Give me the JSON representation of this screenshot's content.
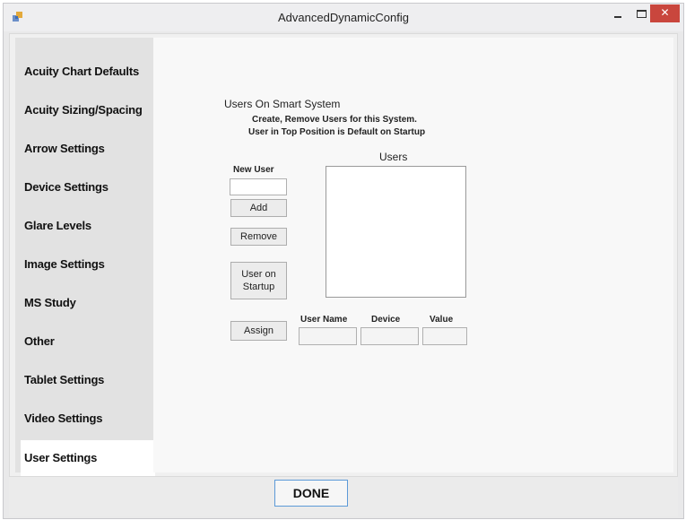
{
  "window": {
    "title": "AdvancedDynamicConfig",
    "controls": {
      "minimize": "–",
      "close": "✕"
    }
  },
  "sidebar": {
    "items": [
      {
        "label": "Acuity Chart Defaults"
      },
      {
        "label": "Acuity Sizing/Spacing"
      },
      {
        "label": "Arrow Settings"
      },
      {
        "label": "Device Settings"
      },
      {
        "label": "Glare Levels"
      },
      {
        "label": "Image Settings"
      },
      {
        "label": "MS Study"
      },
      {
        "label": "Other"
      },
      {
        "label": "Tablet Settings"
      },
      {
        "label": "Video Settings"
      },
      {
        "label": "User Settings",
        "active": true
      }
    ]
  },
  "users_panel": {
    "heading": "Users On Smart System",
    "instructions_line1": "Create, Remove Users for this System.",
    "instructions_line2": "User in Top Position is Default on Startup",
    "new_user_label": "New User",
    "new_user_value": "",
    "add_button": "Add",
    "remove_button": "Remove",
    "user_on_startup_line1": "User on",
    "user_on_startup_line2": "Startup",
    "users_list_label": "Users",
    "users": [],
    "assign_button": "Assign",
    "columns": {
      "user_name": "User Name",
      "device": "Device",
      "value": "Value"
    },
    "assign_values": {
      "user_name": "",
      "device": "",
      "value": ""
    }
  },
  "footer": {
    "done_button": "DONE"
  },
  "colors": {
    "close_button": "#c9463d",
    "done_border": "#5c9ad8",
    "active_tab": "#ffffff"
  }
}
